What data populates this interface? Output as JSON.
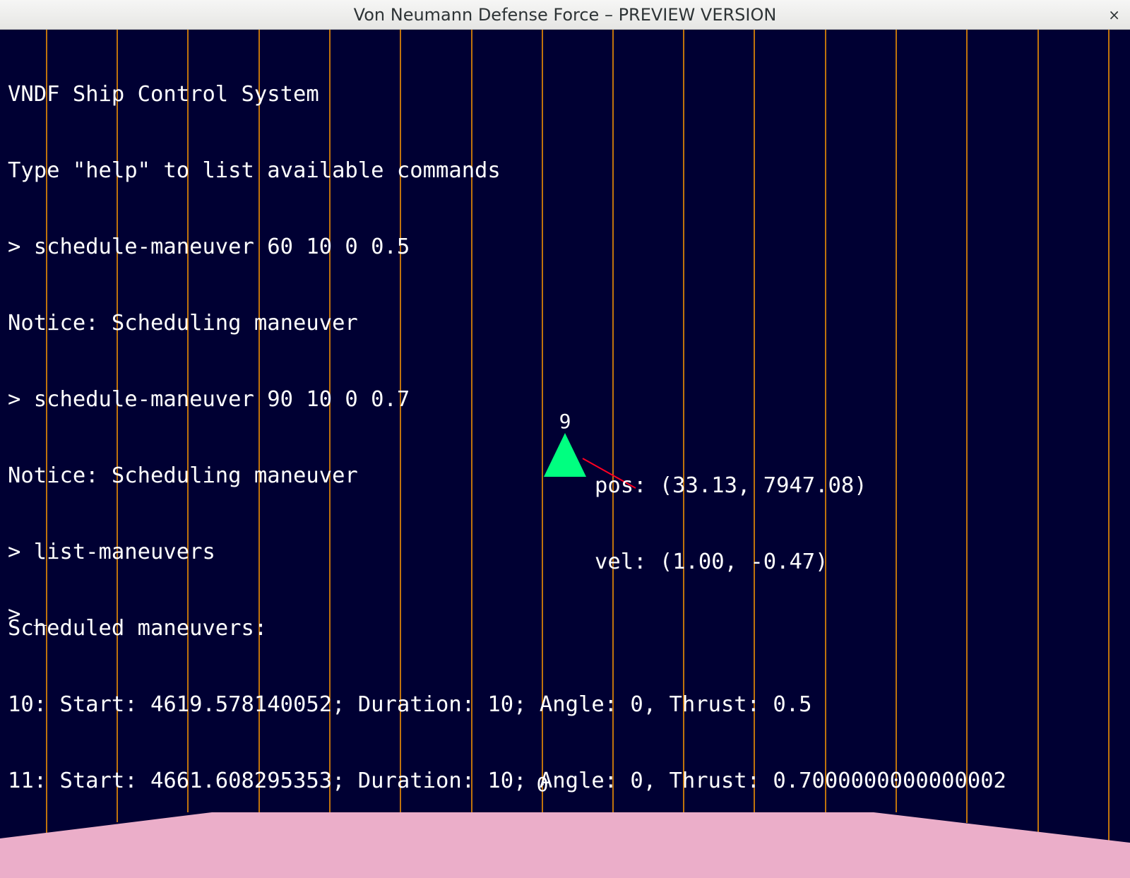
{
  "window": {
    "title": "Von Neumann Defense Force – PREVIEW VERSION",
    "close_glyph": "×"
  },
  "colors": {
    "background": "#000033",
    "grid_line": "#ff9900",
    "ship": "#00ff80",
    "velocity_vector": "#ff0022",
    "ground": "#ebaec9",
    "text": "#ffffff"
  },
  "console": {
    "lines": [
      "VNDF Ship Control System",
      "Type \"help\" to list available commands",
      "> schedule-maneuver 60 10 0 0.5",
      "Notice: Scheduling maneuver",
      "> schedule-maneuver 90 10 0 0.7",
      "Notice: Scheduling maneuver",
      "> list-maneuvers",
      "Scheduled maneuvers:",
      "10: Start: 4619.578140052; Duration: 10; Angle: 0, Thrust: 0.5",
      "11: Start: 4661.608295353; Duration: 10; Angle: 0, Thrust: 0.7000000000000002"
    ],
    "prompt": "> _"
  },
  "ship": {
    "id": "9",
    "icon": "ship-triangle-icon",
    "pos_text": "pos: (33.13, 7947.08)",
    "vel_text": "vel: (1.00, -0.47)",
    "position": {
      "x": 33.13,
      "y": 7947.08
    },
    "velocity": {
      "x": 1.0,
      "y": -0.47
    }
  },
  "ground": {
    "label": "0"
  }
}
